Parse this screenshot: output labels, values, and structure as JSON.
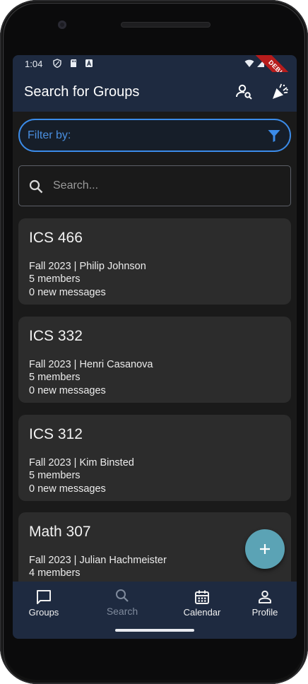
{
  "status_bar": {
    "time": "1:04",
    "debug_label": "DEBUG"
  },
  "app_bar": {
    "title": "Search for Groups",
    "icons": [
      "person-search-icon",
      "celebration-icon"
    ]
  },
  "filter": {
    "label": "Filter by:",
    "icon": "filter-icon"
  },
  "search": {
    "placeholder": "Search...",
    "value": ""
  },
  "groups": [
    {
      "title": "ICS 466",
      "semester_instructor": "Fall 2023 | Philip Johnson",
      "members": "5 members",
      "messages": "0 new messages"
    },
    {
      "title": "ICS 332",
      "semester_instructor": "Fall 2023 | Henri Casanova",
      "members": "5 members",
      "messages": "0 new messages"
    },
    {
      "title": "ICS 312",
      "semester_instructor": "Fall 2023 | Kim Binsted",
      "members": "5 members",
      "messages": "0 new messages"
    },
    {
      "title": "Math 307",
      "semester_instructor": "Fall 2023 | Julian Hachmeister",
      "members": "4 members",
      "messages": ""
    }
  ],
  "fab": {
    "icon": "add-icon"
  },
  "bottom_nav": {
    "items": [
      {
        "label": "Groups",
        "icon": "chat-bubble-icon",
        "active": true
      },
      {
        "label": "Search",
        "icon": "search-icon",
        "active": false
      },
      {
        "label": "Calendar",
        "icon": "calendar-icon",
        "active": true
      },
      {
        "label": "Profile",
        "icon": "profile-icon",
        "active": true
      }
    ]
  },
  "colors": {
    "app_bar": "#1e2a40",
    "background": "#1a1a1a",
    "card": "#2c2c2c",
    "accent_blue": "#3b8be8",
    "fab": "#5ba3b5",
    "debug_ribbon": "#b71c1c"
  }
}
